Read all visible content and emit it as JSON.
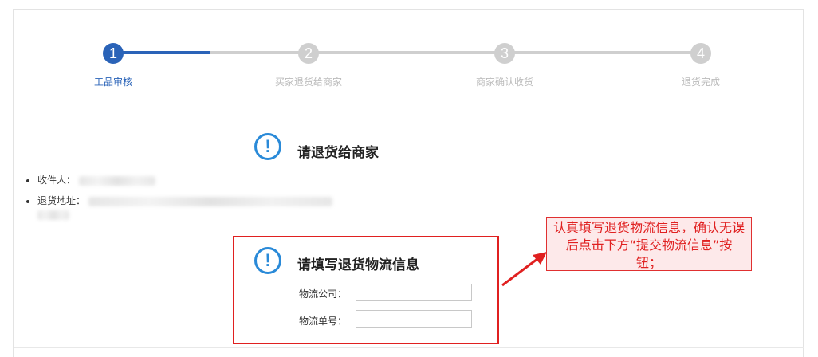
{
  "steps": [
    {
      "number": "1",
      "label": "工品审核",
      "state": "active"
    },
    {
      "number": "2",
      "label": "买家退货给商家",
      "state": "inactive"
    },
    {
      "number": "3",
      "label": "商家确认收货",
      "state": "inactive"
    },
    {
      "number": "4",
      "label": "退货完成",
      "state": "inactive"
    }
  ],
  "return_section": {
    "icon": "exclamation-icon",
    "title": "请退货给商家",
    "recipient_label": "收件人：",
    "address_label": "退货地址："
  },
  "logistics_section": {
    "icon": "exclamation-icon",
    "title": "请填写退货物流信息",
    "company_label": "物流公司：",
    "company_value": "",
    "tracking_label": "物流单号：",
    "tracking_value": ""
  },
  "callout": {
    "text": "认真填写退货物流信息，确认无误后点击下方“提交物流信息”按钮；"
  },
  "colors": {
    "accent": "#2a63b8",
    "inactive": "#cfcfcf",
    "alert_icon": "#2a8ad8",
    "annotation_red": "#e02020"
  }
}
